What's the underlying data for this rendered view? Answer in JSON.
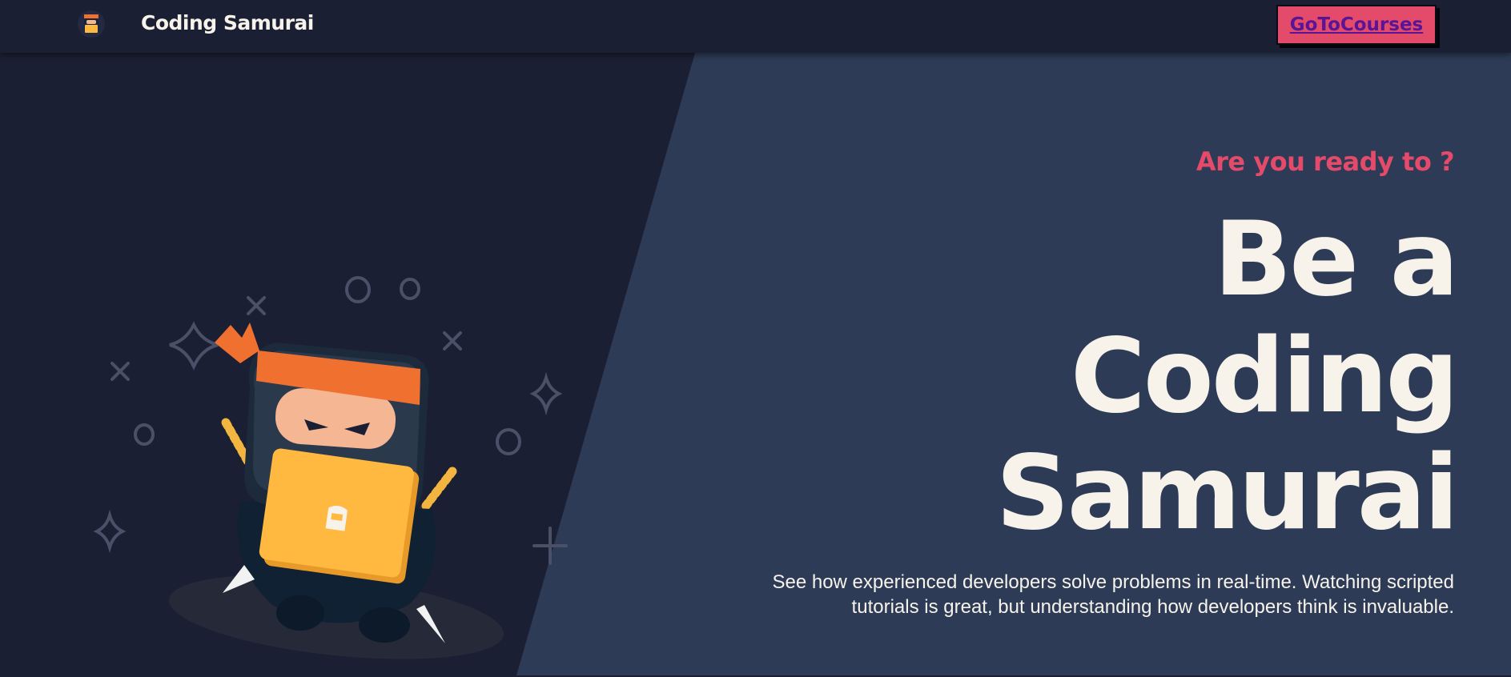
{
  "navbar": {
    "logo_icon": "samurai-mascot-icon",
    "brand_name": "Coding Samurai",
    "cta_label": "GoToCourses"
  },
  "hero": {
    "tagline": "Are you ready to ?",
    "headline_lines": [
      "Be a",
      "Coding",
      "Samurai"
    ],
    "description": "See how experienced developers solve problems in real-time. Watching scripted tutorials is great, but understanding how developers think is invaluable.",
    "illustration": "ninja-with-laptop-illustration"
  },
  "colors": {
    "background_dark": "#1b1f33",
    "panel_right": "#2d3b57",
    "accent_pink": "#e44a6a",
    "text_cream": "#f7f3ea",
    "cta_text": "#5a1496",
    "ninja_orange": "#f07030",
    "laptop_yellow": "#ffb940"
  }
}
